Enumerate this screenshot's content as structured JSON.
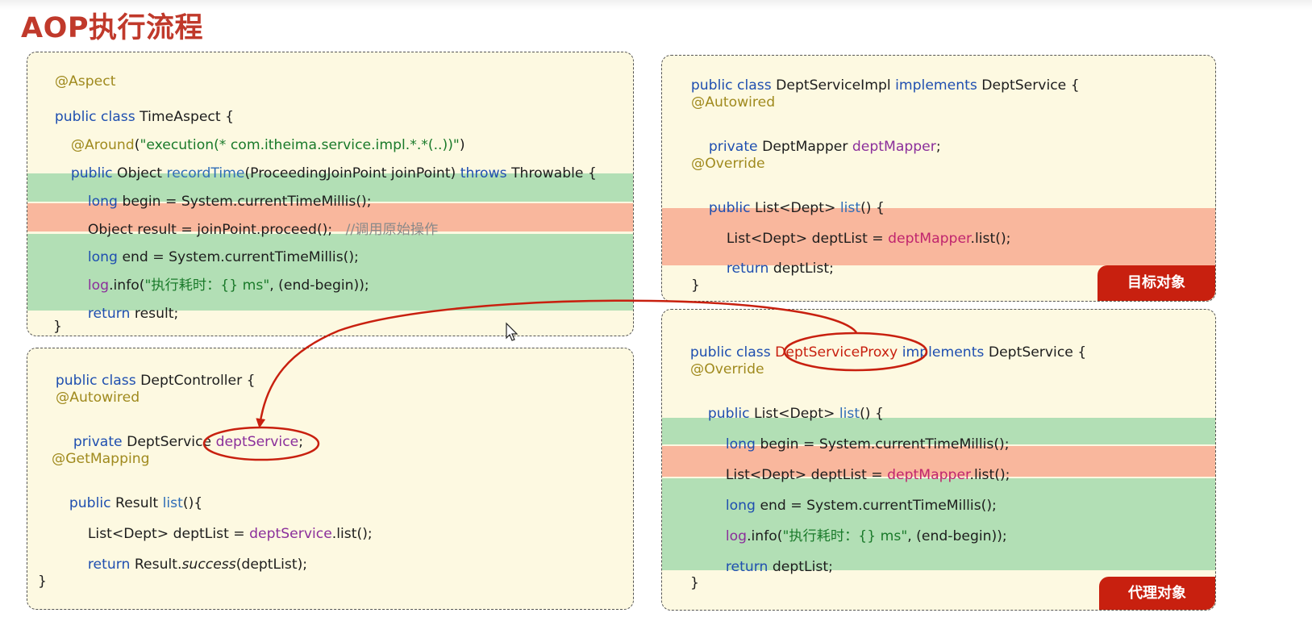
{
  "slide": {
    "title": "AOP执行流程"
  },
  "aspect_panel": {
    "annotation": "@Aspect",
    "class_kw": "public class",
    "class_name": "TimeAspect {",
    "around_annotation": "@Around",
    "around_paren_open": "(",
    "around_expression": "\"execution(* com.itheima.service.impl.*.*(..))\"",
    "around_paren_close": ")",
    "method_public": "public",
    "method_return": "Object",
    "method_name": "recordTime",
    "method_params": "(ProceedingJoinPoint joinPoint)",
    "method_throws": "throws",
    "method_exception": "Throwable {",
    "begin_kw": "long",
    "begin_rest": "begin = System.currentTimeMillis();",
    "proceed_stmt": "Object result = joinPoint.proceed();",
    "proceed_comment": "//调用原始操作",
    "end_kw": "long",
    "end_rest": "end = System.currentTimeMillis();",
    "log_obj": "log",
    "log_call": ".info(",
    "log_string": "\"执行耗时：{} ms\"",
    "log_args": ", (end-begin));",
    "return_kw": "return",
    "return_rest": "result;",
    "close_brace": "}"
  },
  "controller_panel": {
    "class_kw": "public class",
    "class_name": "DeptController {",
    "autowired": "@Autowired",
    "private_kw": "private",
    "field_type": "DeptService",
    "field_name": "deptService",
    "field_semicolon": ";",
    "getmapping": "@GetMapping",
    "method_public": "public",
    "method_return": "Result",
    "method_name": "list",
    "method_rest": "(){",
    "stmt_type": "List<Dept> deptList =",
    "stmt_field": "deptService",
    "stmt_call": ".list();",
    "return_kw": "return",
    "return_class": "Result.",
    "return_method": "success",
    "return_args": "(deptList);",
    "close_brace": "}"
  },
  "impl_panel": {
    "class_kw": "public class",
    "class_name": "DeptServiceImpl",
    "implements_kw": "implements",
    "interface_name": "DeptService {",
    "autowired": "@Autowired",
    "private_kw": "private",
    "field_type": "DeptMapper",
    "field_name": "deptMapper",
    "field_semicolon": ";",
    "override": "@Override",
    "method_public": "public",
    "method_return": "List<Dept>",
    "method_name": "list",
    "method_rest": "() {",
    "stmt_type": "List<Dept> deptList =",
    "stmt_field": "deptMapper",
    "stmt_call": ".list();",
    "return_kw": "return",
    "return_rest": "deptList;",
    "close_brace": "}",
    "badge": "目标对象"
  },
  "proxy_panel": {
    "class_kw": "public class",
    "class_name": "DeptServiceProxy",
    "implements_kw": "implements",
    "interface_name": "DeptService {",
    "override": "@Override",
    "method_public": "public",
    "method_return": "List<Dept>",
    "method_name": "list",
    "method_rest": "() {",
    "begin_kw": "long",
    "begin_rest": "begin = System.currentTimeMillis();",
    "stmt_type": "List<Dept> deptList =",
    "stmt_field": "deptMapper",
    "stmt_call": ".list();",
    "end_kw": "long",
    "end_rest": "end = System.currentTimeMillis();",
    "log_obj": "log",
    "log_call": ".info(",
    "log_string": "\"执行耗时：{} ms\"",
    "log_args": ", (end-begin));",
    "return_kw": "return",
    "return_rest": "deptList;",
    "close_brace": "}",
    "badge": "代理对象"
  },
  "colors": {
    "title": "#c0392b",
    "advice_highlight": "#b2dfb5",
    "original_call_highlight": "#f9b79d",
    "panel_background": "#fdf9e1",
    "badge": "#c8200f",
    "annotation_ring": "#c8200f"
  }
}
